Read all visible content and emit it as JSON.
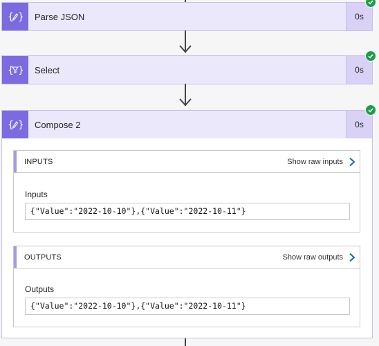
{
  "steps": [
    {
      "title": "Parse JSON",
      "duration": "0s",
      "icon": "parse-json-icon",
      "status": "success"
    },
    {
      "title": "Select",
      "duration": "0s",
      "icon": "select-filter-icon",
      "status": "success"
    },
    {
      "title": "Compose 2",
      "duration": "0s",
      "icon": "compose-icon",
      "status": "success"
    }
  ],
  "compose": {
    "inputs_header": "INPUTS",
    "show_raw_inputs": "Show raw inputs",
    "inputs_label": "Inputs",
    "inputs_value": "{\"Value\":\"2022-10-10\"},{\"Value\":\"2022-10-11\"}",
    "outputs_header": "OUTPUTS",
    "show_raw_outputs": "Show raw outputs",
    "outputs_label": "Outputs",
    "outputs_value": "{\"Value\":\"2022-10-10\"},{\"Value\":\"2022-10-11\"}"
  },
  "colors": {
    "accent": "#7b6ae0",
    "card_bg": "#ece8fb",
    "success": "#1e9e4a",
    "link_chevron": "#1f5fc4"
  }
}
